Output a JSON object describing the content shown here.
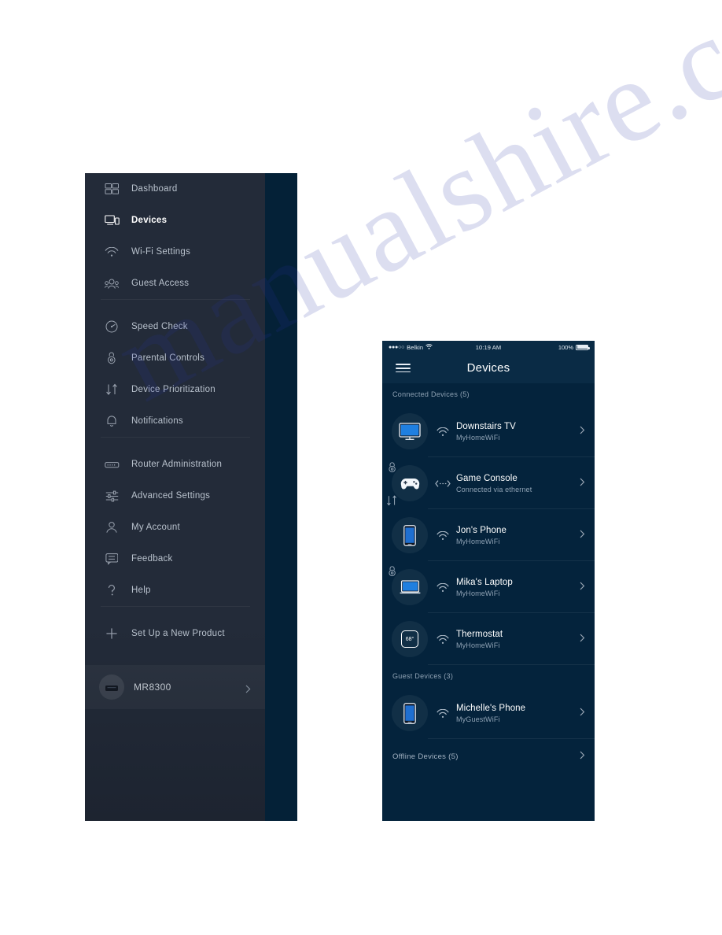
{
  "page": {
    "watermark": "manualshire.com"
  },
  "menu_panel": {
    "hamburger_icon": "hamburger-icon",
    "items": [
      {
        "label": "Dashboard",
        "icon": "dashboard-icon",
        "active": false
      },
      {
        "label": "Devices",
        "icon": "devices-icon",
        "active": true
      },
      {
        "label": "Wi-Fi Settings",
        "icon": "wifi-icon",
        "active": false
      },
      {
        "label": "Guest Access",
        "icon": "guest-access-icon",
        "active": false
      },
      {
        "label": "Speed Check",
        "icon": "speedometer-icon",
        "active": false
      },
      {
        "label": "Parental Controls",
        "icon": "parental-controls-icon",
        "active": false
      },
      {
        "label": "Device Prioritization",
        "icon": "prioritization-arrows-icon",
        "active": false
      },
      {
        "label": "Notifications",
        "icon": "bell-icon",
        "active": false
      },
      {
        "label": "Router Administration",
        "icon": "router-icon",
        "active": false
      },
      {
        "label": "Advanced Settings",
        "icon": "sliders-icon",
        "active": false
      },
      {
        "label": "My Account",
        "icon": "person-icon",
        "active": false
      },
      {
        "label": "Feedback",
        "icon": "speech-bubble-icon",
        "active": false
      },
      {
        "label": "Help",
        "icon": "question-mark-icon",
        "active": false
      },
      {
        "label": "Set Up a New Product",
        "icon": "plus-icon",
        "active": false
      }
    ],
    "router": {
      "name": "MR8300",
      "thumb_icon": "router-thumb-icon",
      "chevron_icon": "chevron-right-icon"
    }
  },
  "phone_panel": {
    "status_bar": {
      "signal_dots": "●●●○○",
      "carrier": "Belkin",
      "wifi_icon": "wifi-icon",
      "time": "10:19 AM",
      "battery_percent": "100%",
      "battery_icon": "battery-full-icon"
    },
    "header": {
      "menu_icon": "hamburger-icon",
      "title": "Devices"
    },
    "sections": [
      {
        "label": "Connected Devices (5)",
        "devices": [
          {
            "name": "Downstairs TV",
            "network": "MyHomeWiFi",
            "device_icon": "tv-icon",
            "connection_icon": "wifi-icon",
            "badges": [],
            "chevron_icon": "chevron-right-icon"
          },
          {
            "name": "Game Console",
            "network": "Connected via ethernet",
            "device_icon": "game-controller-icon",
            "connection_icon": "ethernet-icon",
            "badges": [
              "parental-controls-badge-icon",
              "prioritization-badge-icon"
            ],
            "chevron_icon": "chevron-right-icon"
          },
          {
            "name": "Jon's Phone",
            "network": "MyHomeWiFi",
            "device_icon": "smartphone-icon",
            "connection_icon": "wifi-icon",
            "badges": [],
            "chevron_icon": "chevron-right-icon"
          },
          {
            "name": "Mika's Laptop",
            "network": "MyHomeWiFi",
            "device_icon": "laptop-icon",
            "connection_icon": "wifi-icon",
            "badges": [
              "parental-controls-badge-icon"
            ],
            "chevron_icon": "chevron-right-icon"
          },
          {
            "name": "Thermostat",
            "network": "MyHomeWiFi",
            "device_icon": "thermostat-icon",
            "device_icon_label": "68°",
            "connection_icon": "wifi-icon",
            "badges": [],
            "chevron_icon": "chevron-right-icon"
          }
        ]
      },
      {
        "label": "Guest Devices (3)",
        "devices": [
          {
            "name": "Michelle's Phone",
            "network": "MyGuestWiFi",
            "device_icon": "smartphone-icon",
            "connection_icon": "wifi-icon",
            "badges": [],
            "chevron_icon": "chevron-right-icon"
          }
        ]
      }
    ],
    "offline": {
      "label": "Offline Devices (5)",
      "chevron_icon": "chevron-right-icon"
    }
  },
  "colors": {
    "page_bg": "#ffffff",
    "drawer_bg": "#232b39",
    "rail_navy": "#042137",
    "phone_bg": "#04233c",
    "phone_header": "#0a2b45",
    "text_primary": "#ffffff",
    "text_muted": "#8fa2b4"
  }
}
